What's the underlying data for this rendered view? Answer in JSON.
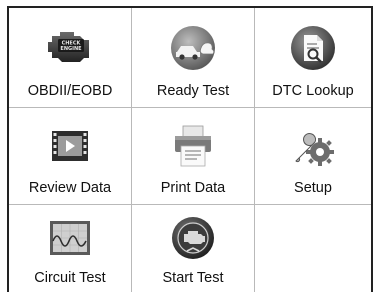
{
  "menu": {
    "items": [
      {
        "label": "OBDII/EOBD",
        "icon": "check-engine-icon"
      },
      {
        "label": "Ready Test",
        "icon": "car-emission-icon"
      },
      {
        "label": "DTC Lookup",
        "icon": "dtc-lookup-icon"
      },
      {
        "label": "Review Data",
        "icon": "film-icon"
      },
      {
        "label": "Print Data",
        "icon": "printer-icon"
      },
      {
        "label": "Setup",
        "icon": "wrench-gear-icon"
      },
      {
        "label": "Circuit Test",
        "icon": "oscilloscope-icon"
      },
      {
        "label": "Start Test",
        "icon": "engine-start-icon"
      }
    ],
    "engine_badge_text": "CHECK ENGINE"
  },
  "colors": {
    "border": "#222222",
    "divider": "#b9b9b9",
    "text": "#111111",
    "icon_dark": "#3a3a3a",
    "icon_mid": "#8a8a8a",
    "icon_light": "#cfcfcf"
  }
}
